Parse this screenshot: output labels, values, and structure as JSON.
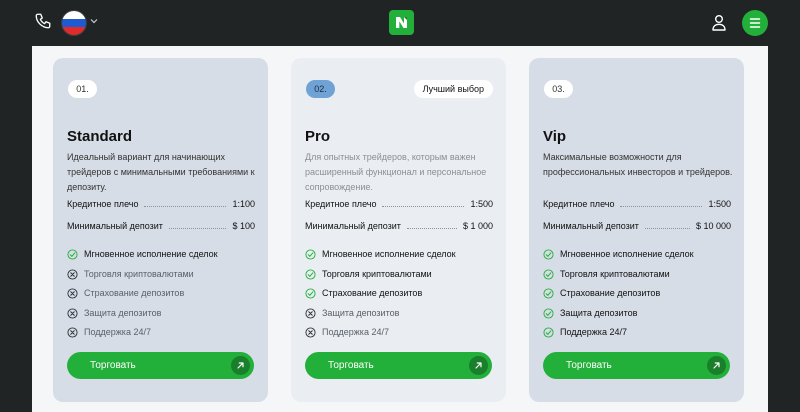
{
  "header": {
    "phone_icon": "phone-icon",
    "language_flag": "russia-flag",
    "logo_icon": "logo-n-icon",
    "user_icon": "user-icon",
    "menu_icon": "hamburger-menu-icon",
    "accent_color": "#22b03a"
  },
  "plans": [
    {
      "number": "01.",
      "title": "Standard",
      "description": "Идеальный вариант для начинающих трейдеров с минимальными требованиями к депозиту.",
      "leverage_label": "Кредитное плечо",
      "leverage_value": "1:100",
      "deposit_label": "Минимальный депозит",
      "deposit_value": "$ 100",
      "features": [
        {
          "label": "Мгновенное исполнение сделок",
          "included": true
        },
        {
          "label": "Торговля криптовалютами",
          "included": false
        },
        {
          "label": "Страхование депозитов",
          "included": false
        },
        {
          "label": "Защита депозитов",
          "included": false
        },
        {
          "label": "Поддержка 24/7",
          "included": false
        }
      ],
      "button_label": "Торговать"
    },
    {
      "number": "02.",
      "badge": "Лучший выбор",
      "title": "Pro",
      "description": "Для опытных трейдеров, которым важен расширенный функционал и персональное сопровождение.",
      "leverage_label": "Кредитное плечо",
      "leverage_value": "1:500",
      "deposit_label": "Минимальный депозит",
      "deposit_value": "$ 1 000",
      "features": [
        {
          "label": "Мгновенное исполнение сделок",
          "included": true
        },
        {
          "label": "Торговля криптовалютами",
          "included": true
        },
        {
          "label": "Страхование депозитов",
          "included": true
        },
        {
          "label": "Защита депозитов",
          "included": false
        },
        {
          "label": "Поддержка 24/7",
          "included": false
        }
      ],
      "button_label": "Торговать"
    },
    {
      "number": "03.",
      "title": "Vip",
      "description": "Максимальные возможности для профессиональных инвесторов и трейдеров.",
      "leverage_label": "Кредитное плечо",
      "leverage_value": "1:500",
      "deposit_label": "Минимальный депозит",
      "deposit_value": "$ 10 000",
      "features": [
        {
          "label": "Мгновенное исполнение сделок",
          "included": true
        },
        {
          "label": "Торговля криптовалютами",
          "included": true
        },
        {
          "label": "Страхование депозитов",
          "included": true
        },
        {
          "label": "Защита депозитов",
          "included": true
        },
        {
          "label": "Поддержка 24/7",
          "included": true
        }
      ],
      "button_label": "Торговать"
    }
  ]
}
